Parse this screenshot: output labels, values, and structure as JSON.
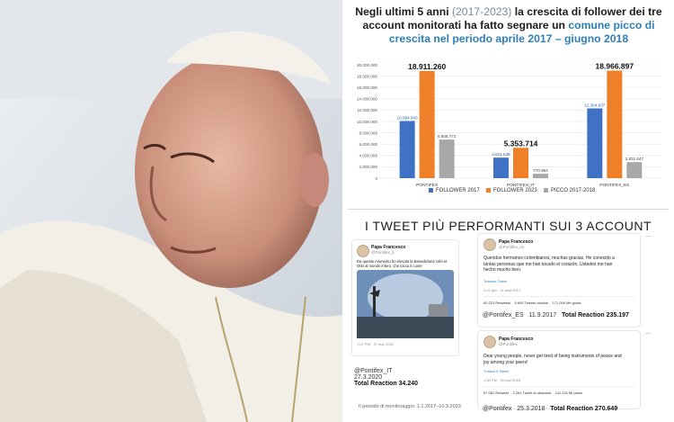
{
  "headline": {
    "part1": "Negli ultimi 5 anni ",
    "years": "(2017-2023)",
    "part2": " la crescita di follower dei tre account monitorati ha fatto segnare un ",
    "highlight": "comune picco di crescita nel periodo aprile 2017 – giugno 2018"
  },
  "colors": {
    "follower_2017": "#3f72c4",
    "follower_2023": "#f07f2a",
    "picco": "#a8a8a8",
    "highlight": "#2e7fb8"
  },
  "chart_data": {
    "type": "bar",
    "categories": [
      "PONTIFEX",
      "PONTIFEX_IT",
      "PONTIFEX_ES"
    ],
    "series": [
      {
        "name": "FOLLOWER 2017",
        "values": [
          10084643,
          3621635,
          12304837
        ],
        "labels": [
          "10.084.643",
          "3.621.635",
          "12.304.837"
        ]
      },
      {
        "name": "FOLLOWER 2023",
        "values": [
          18911260,
          5353714,
          18966897
        ],
        "labels": [
          "18.911.260",
          "5.353.714",
          "18.966.897"
        ]
      },
      {
        "name": "PICCO 2017-2018",
        "values": [
          6805772,
          770994,
          2831647
        ],
        "labels": [
          "6.805.772",
          "770.994",
          "2.831.647"
        ]
      }
    ],
    "yticks": [
      "0",
      "2.000.000",
      "4.000.000",
      "6.000.000",
      "8.000.000",
      "10.000.000",
      "12.000.000",
      "14.000.000",
      "16.000.000",
      "18.000.000",
      "20.000.000"
    ],
    "ylim": [
      0,
      20000000
    ],
    "grid": true,
    "legend": "bottom",
    "xlabel": "",
    "ylabel": ""
  },
  "section_title": "I TWEET PIÙ PERFORMANTI SUI 3 ACCOUNT",
  "tweets": [
    {
      "name": "Papa Francesco",
      "handle": "@Pontifex_it",
      "text": "Da questo momento ho elevato la Benedizione Urbi et Orbi al mondo intero, che tocca il cuore",
      "meta": "7:07 PM · 27 mar 2020",
      "caption_account": "@Pontifex_IT",
      "caption_date": "27.3.2020",
      "caption_reaction": "Total Reaction 34.240"
    },
    {
      "name": "Papa Francesco",
      "handle": "@Pontifex_es",
      "text": "Queridos hermanos colombianos, muchas gracias. He conocido a tantas personas que me han tocado el corazón. Ustedes me han hecho mucho bien.",
      "translate": "Traducir Tweet",
      "meta": "3:22 AM · 11 sept 2017",
      "stats": "60.223 Retweets    5.605 Tweets citados    171.009 Me gusta",
      "caption_account": "@Pontifex_ES",
      "caption_date": "11.9.2017",
      "caption_reaction": "Total Reaction 235.197"
    },
    {
      "name": "Papa Francesco",
      "handle": "@Pontifex",
      "text": "Dear young people, never get tired of being instruments of peace and joy among your peers!",
      "translate": "Traduci il Tweet",
      "meta": "1:30 PM · 25 mar 2018",
      "stats": "57.081 Retweet    2.261 Tweet di citazione    211.101 Mi piace",
      "caption_account": "@Pontifex",
      "caption_date": "25.3.2018",
      "caption_reaction": "Total Reaction 270.649"
    }
  ],
  "footnote": "Il periodo di monitoraggio: 1.1.2017–10.3.2023"
}
